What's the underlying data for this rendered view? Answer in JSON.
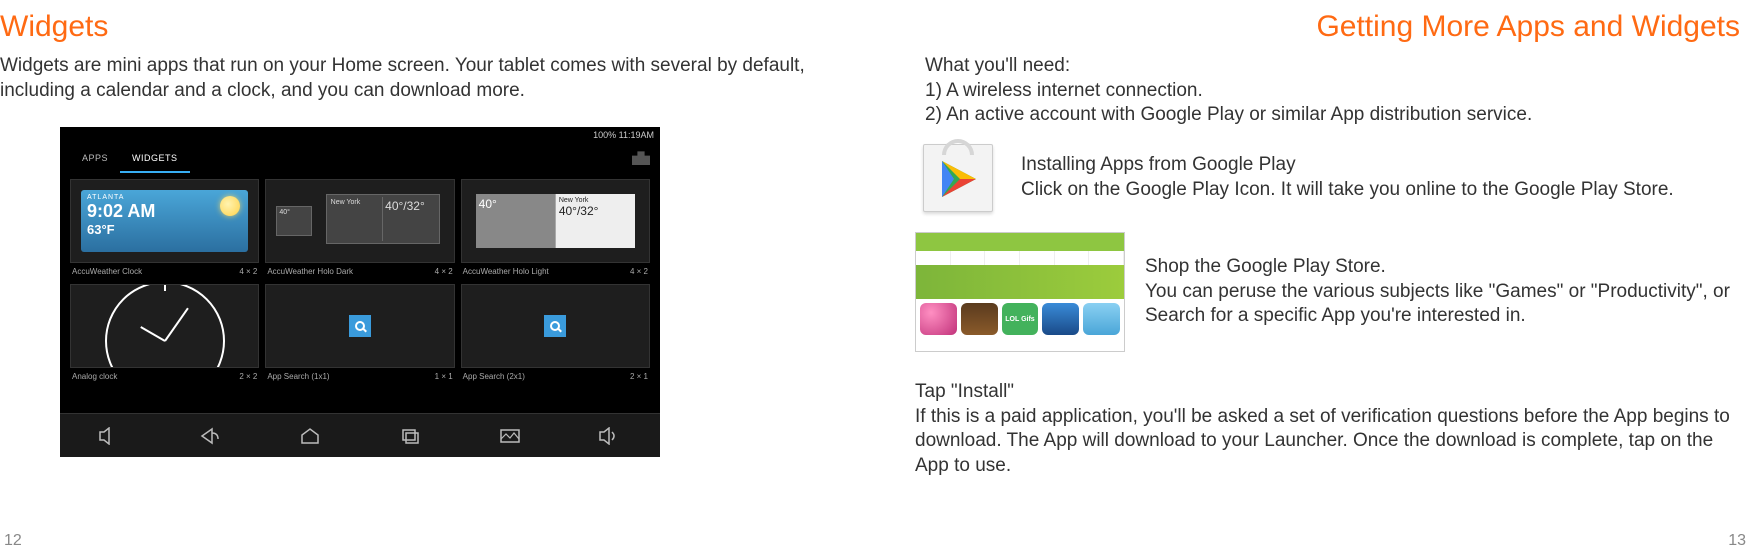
{
  "left": {
    "heading": "Widgets",
    "intro": "Widgets are mini apps that run on your Home screen. Your tablet comes with several by default, including a calendar and a clock, and you can download more.",
    "page_number": "12",
    "tablet": {
      "status_left": "",
      "status_right": "100%   11:19AM",
      "tab_apps": "APPS",
      "tab_widgets": "WIDGETS",
      "cells": [
        {
          "label": "AccuWeather Clock",
          "size": "4 × 2",
          "city": "ATLANTA",
          "time": "9:02 AM",
          "temp": "63°F"
        },
        {
          "label": "AccuWeather Holo Dark",
          "size": "4 × 2",
          "small_temp": "40°",
          "city_b": "New York",
          "hi_lo": "40°/32°"
        },
        {
          "label": "AccuWeather Holo Light",
          "size": "4 × 2",
          "small_temp": "40°",
          "city_b": "New York",
          "hi_lo": "40°/32°"
        },
        {
          "label": "Analog clock",
          "size": "2 × 2"
        },
        {
          "label": "App Search (1x1)",
          "size": "1 × 1"
        },
        {
          "label": "App Search (2x1)",
          "size": "2 × 1"
        }
      ]
    }
  },
  "right": {
    "heading": "Getting More Apps and Widgets",
    "need_title": "What you'll need:",
    "need_1": "1) A wireless internet connection.",
    "need_2": "2) An active account with Google Play or similar App distribution service.",
    "gp_title": "Installing Apps from Google Play",
    "gp_text": "Click on the Google Play Icon.  It will take you online to the Google Play Store.",
    "store_title": "Shop the Google Play Store.",
    "store_text": "You can peruse the various subjects like \"Games\" or \"Productivity\", or Search for a specific App you're interested in.",
    "lol_label": "LOL Gifs",
    "install_title": "Tap \"Install\"",
    "install_text": "If this is a paid application, you'll be asked a set of verification questions before the App begins to download.  The App will download to your Launcher.  Once the download is complete, tap on the App to use.",
    "page_number": "13"
  }
}
